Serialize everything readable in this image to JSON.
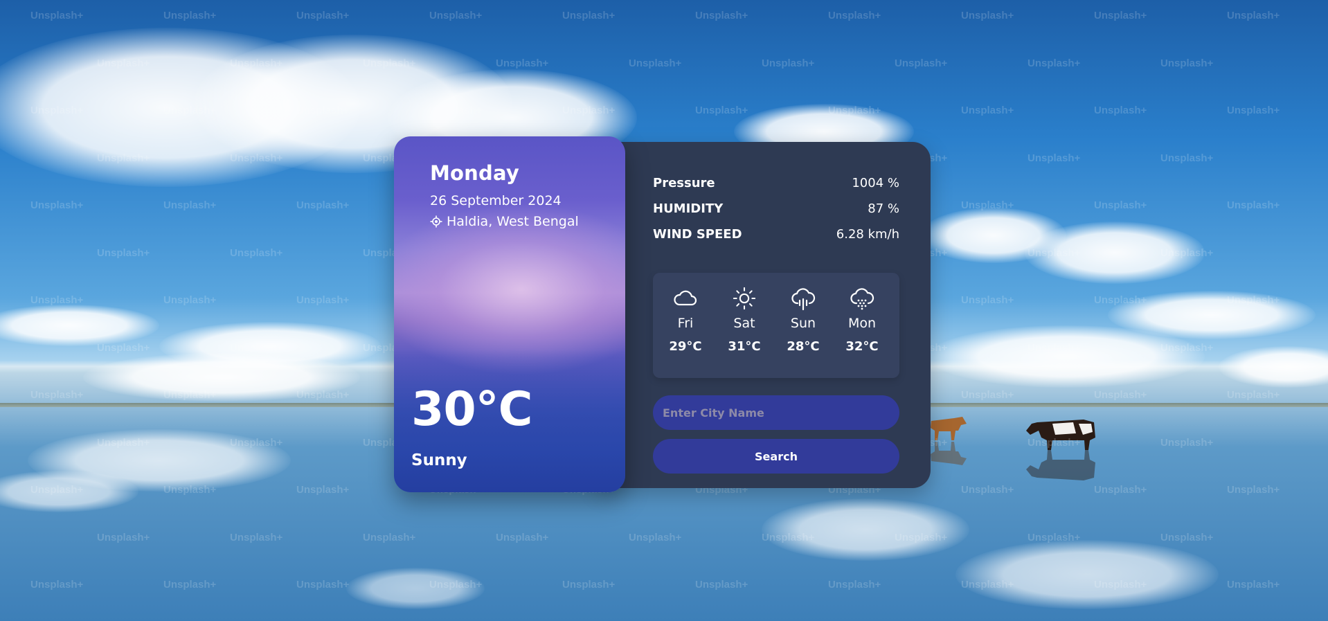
{
  "background": {
    "watermark": "Unsplash+"
  },
  "current": {
    "day": "Monday",
    "date": "26 September 2024",
    "location": "Haldia, West Bengal",
    "location_icon": "location-target-icon",
    "temperature": "30°C",
    "condition": "Sunny"
  },
  "stats": [
    {
      "label": "Pressure",
      "value": "1004 %"
    },
    {
      "label": "HUMIDITY",
      "value": "87 %"
    },
    {
      "label": "WIND SPEED",
      "value": "6.28 km/h"
    }
  ],
  "forecast": [
    {
      "day": "Fri",
      "temp": "29°C",
      "icon": "cloud-icon"
    },
    {
      "day": "Sat",
      "temp": "31°C",
      "icon": "sun-icon"
    },
    {
      "day": "Sun",
      "temp": "28°C",
      "icon": "rain-icon"
    },
    {
      "day": "Mon",
      "temp": "32°C",
      "icon": "snow-icon"
    }
  ],
  "search": {
    "placeholder": "Enter City Name",
    "value": "",
    "button_label": "Search"
  },
  "colors": {
    "panel": "#2e3a53",
    "forecast_box": "#364260",
    "accent": "#323b9a",
    "placeholder": "#8d8aa8"
  }
}
